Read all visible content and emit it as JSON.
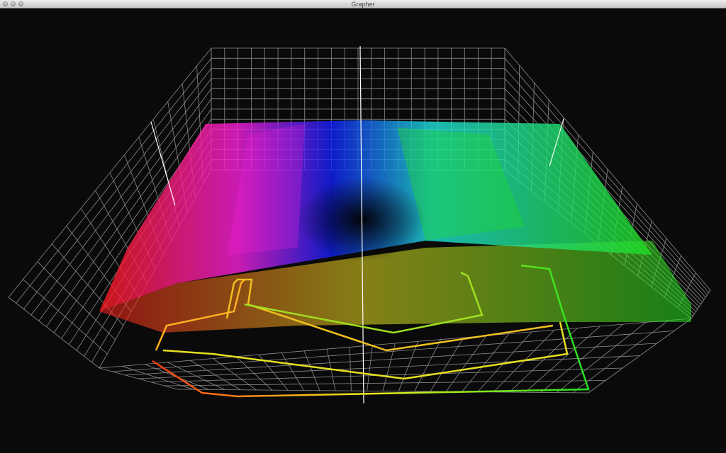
{
  "window": {
    "title": "Grapher"
  },
  "controls": {
    "close": "close",
    "minimize": "minimize",
    "zoom": "zoom"
  },
  "plot": {
    "grid_color": "#8c8c8c",
    "axis_color": "#ffffff",
    "colors": {
      "red": "#ff1a1a",
      "magenta": "#ff20e0",
      "blue": "#1020ff",
      "cyan": "#20e8e0",
      "green": "#20e020",
      "yellow": "#e8e020",
      "orange": "#ff6a10"
    }
  }
}
